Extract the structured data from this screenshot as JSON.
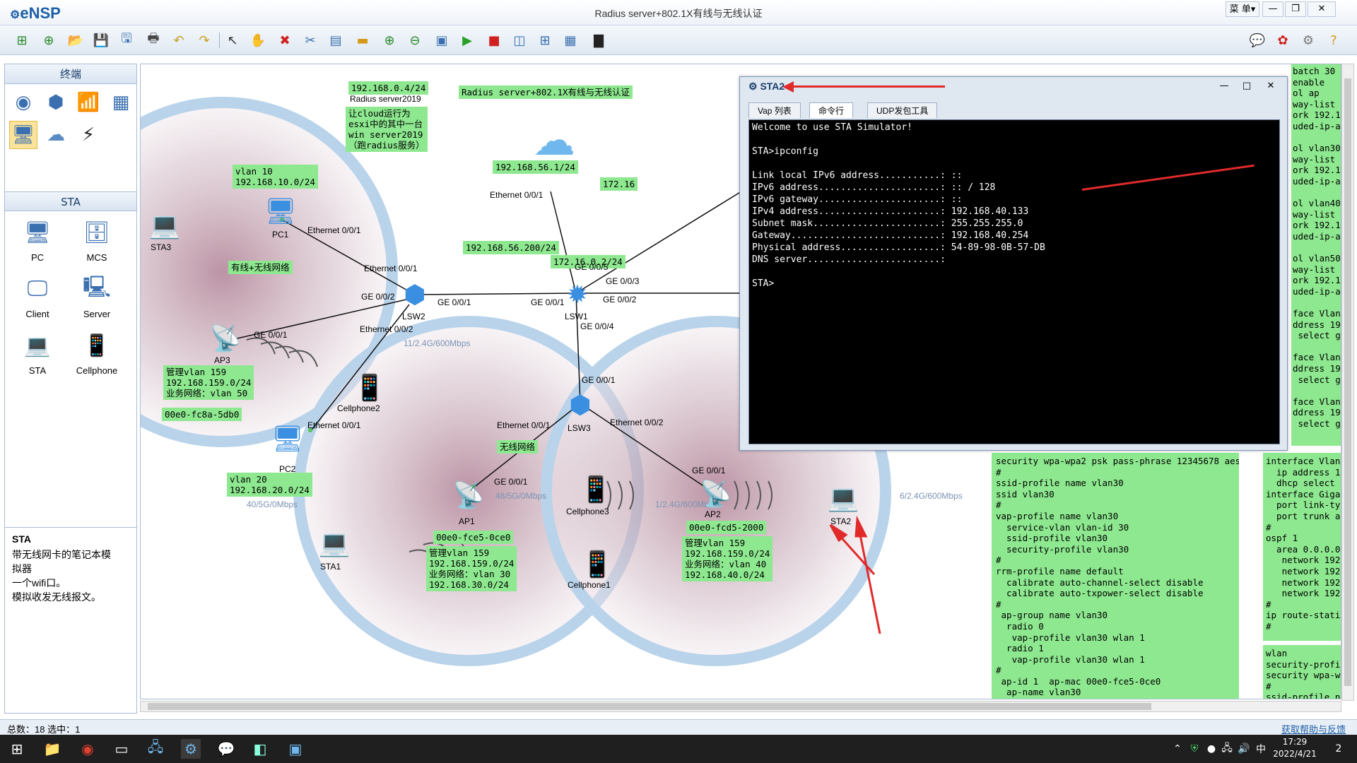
{
  "app": {
    "logo": "eNSP",
    "title": "Radius  server+802.1X有线与无线认证",
    "menu": "菜 单▾",
    "minimize": "—",
    "restore": "❐",
    "close": "✕"
  },
  "toolbar": {
    "icons": [
      "new-topology-icon",
      "new-icon",
      "open-icon",
      "save-icon",
      "save-as-icon",
      "print-icon",
      "undo-icon",
      "redo-icon",
      "select-icon",
      "pan-icon",
      "delete-icon",
      "delete-link-icon",
      "text-icon",
      "palette-icon",
      "zoom-in-icon",
      "zoom-out-icon",
      "fit-icon",
      "start-icon",
      "stop-icon",
      "capture-icon",
      "topology-icon",
      "grid-icon",
      "terminal-icon"
    ],
    "right_icons": [
      "chat-icon",
      "huawei-icon",
      "settings-icon",
      "help-icon"
    ]
  },
  "left_panel": {
    "terminal_header": "终端",
    "sta_header": "STA",
    "devices": [
      {
        "name": "PC",
        "icon": "🖥"
      },
      {
        "name": "MCS",
        "icon": "🗄"
      },
      {
        "name": "Client",
        "icon": "🖥"
      },
      {
        "name": "Server",
        "icon": "🖥"
      },
      {
        "name": "STA",
        "icon": "💻"
      },
      {
        "name": "Cellphone",
        "icon": "📱"
      }
    ],
    "info_title": "STA",
    "info_line1": "带无线网卡的笔记本模",
    "info_line2": "拟器",
    "info_line3": "一个wifi口。",
    "info_line4": "模拟收发无线报文。"
  },
  "topology": {
    "labels": {
      "title": "Radius server+802.1X有线与无线认证",
      "srv_ip": "192.168.0.4/24",
      "srv_name": "Radius server2019",
      "srv_note": "让cloud运行为\nesxi中的其中一台\nwin server2019\n（跑radius服务）",
      "cloud_ip": "192.168.56.1/24",
      "cloud_eth": "Ethernet 0/0/1",
      "lsw1_ip": "192.168.56.200/24",
      "lsw1_ip2": "172.16.0.2/24",
      "peer_ip": "172.16",
      "vlan10": "vlan 10\n192.168.10.0/24",
      "wired_wireless": "有线+无线网络",
      "wireless": "无线网络",
      "vlan20": "vlan 20\n192.168.20.0/24",
      "ap3_info": "管理vlan 159\n192.168.159.0/24\n业务网络：vlan 50",
      "ap3_mac": "00e0-fc8a-5db0",
      "ap1_mac": "00e0-fce5-0ce0",
      "ap1_info": "管理vlan 159\n192.168.159.0/24\n业务网络：vlan 30\n192.168.30.0/24",
      "ap2_mac": "00e0-fcd5-2000",
      "ap2_info": "管理vlan 159\n192.168.159.0/24\n业务网络：vlan 40\n192.168.40.0/24",
      "radio_ap3": "11/2.4G/600Mbps",
      "radio_pc2": "40/5G/0Mbps",
      "radio_ap1": "48/5G/0Mbps",
      "radio_ap2": "1/2.4G/600Mbps",
      "radio_sta2": "6/2.4G/600Mbps"
    },
    "ports": {
      "pc1_eth": "Ethernet 0/0/1",
      "lsw2_eth1": "Ethernet 0/0/1",
      "lsw2_ge2": "GE 0/0/2",
      "ap3_ge1": "GE 0/0/1",
      "lsw2_eth2": "Ethernet 0/0/2",
      "lsw2_ge1": "GE 0/0/1",
      "lsw1_ge1": "GE 0/0/1",
      "lsw1_ge5": "GE 0/0/5",
      "lsw1_ge3": "GE 0/0/3",
      "lsw1_ge2": "GE 0/0/2",
      "lsw1_ge4": "GE 0/0/4",
      "lsw3_ge1": "GE 0/0/1",
      "pc2_eth": "Ethernet 0/0/1",
      "lsw3_eth1": "Ethernet 0/0/1",
      "lsw3_eth2": "Ethernet 0/0/2",
      "ap1_ge1": "GE 0/0/1",
      "ap2_ge1": "GE 0/0/1"
    },
    "nodes": {
      "pc1": "PC1",
      "lsw2": "LSW2",
      "lsw1": "LSW1",
      "lsw3": "LSW3",
      "ap3": "AP3",
      "ap1": "AP1",
      "ap2": "AP2",
      "sta3": "STA3",
      "sta1": "STA1",
      "sta2": "STA2",
      "pc2": "PC2",
      "cellphone1": "Cellphone1",
      "cellphone2": "Cellphone2",
      "cellphone3": "Cellphone3"
    }
  },
  "config_panel_mid": "security wpa-wpa2 psk pass-phrase 12345678 aes\n#\nssid-profile name vlan30\nssid vlan30\n#\nvap-profile name vlan30\n  service-vlan vlan-id 30\n  ssid-profile vlan30\n  security-profile vlan30\n#\nrrm-profile name default\n  calibrate auto-channel-select disable\n  calibrate auto-txpower-select disable\n#\n ap-group name vlan30\n  radio 0\n   vap-profile vlan30 wlan 1\n  radio 1\n   vap-profile vlan30 wlan 1\n#\n ap-id 1  ap-mac 00e0-fce5-0ce0\n  ap-name vlan30",
  "config_panel_right_top": "batch 30\nenable\nol ap\nway-list\nork 192.1\nuded-ip-a\n\nol vlan30\nway-list\nork 192.1\nuded-ip-a\n\nol vlan40\nway-list\nork 192.1\nuded-ip-a\n\nol vlan50\nway-list\nork 192.1\nuded-ip-a\n\nface Vlan\nddress 19\n select g\n\nface Vlan\nddress 19\n select g\n\nface Vlan\nddress 19\n select g",
  "config_panel_right_mid": "interface Vlan\n  ip address 19\n  dhcp select g\ninterface Gigal\n  port link-typ\n  port trunk al\n#\nospf 1\n  area 0.0.0.0\n   network 192.\n   network 192.\n   network 192.\n   network 192.\n#\nip route-stati\n#",
  "config_panel_right_bot": "wlan\nsecurity-profi\nsecurity wpa-w\n#\nssid-profile n",
  "sta2_window": {
    "title": "STA2",
    "tabs": [
      "Vap 列表",
      "命令行",
      "UDP发包工具"
    ],
    "terminal": "Welcome to use STA Simulator!\n\nSTA>ipconfig\n\nLink local IPv6 address...........: ::\nIPv6 address......................: :: / 128\nIPv6 gateway......................: ::\nIPv4 address......................: 192.168.40.133\nSubnet mask.......................: 255.255.255.0\nGateway...........................: 192.168.40.254\nPhysical address..................: 54-89-98-0B-57-DB\nDNS server........................:\n\nSTA>"
  },
  "status": {
    "left": "总数：18 选中：1",
    "right": "获取帮助与反馈"
  },
  "taskbar": {
    "time": "17:29",
    "date": "2022/4/21",
    "ime": "中",
    "notify": "2"
  }
}
